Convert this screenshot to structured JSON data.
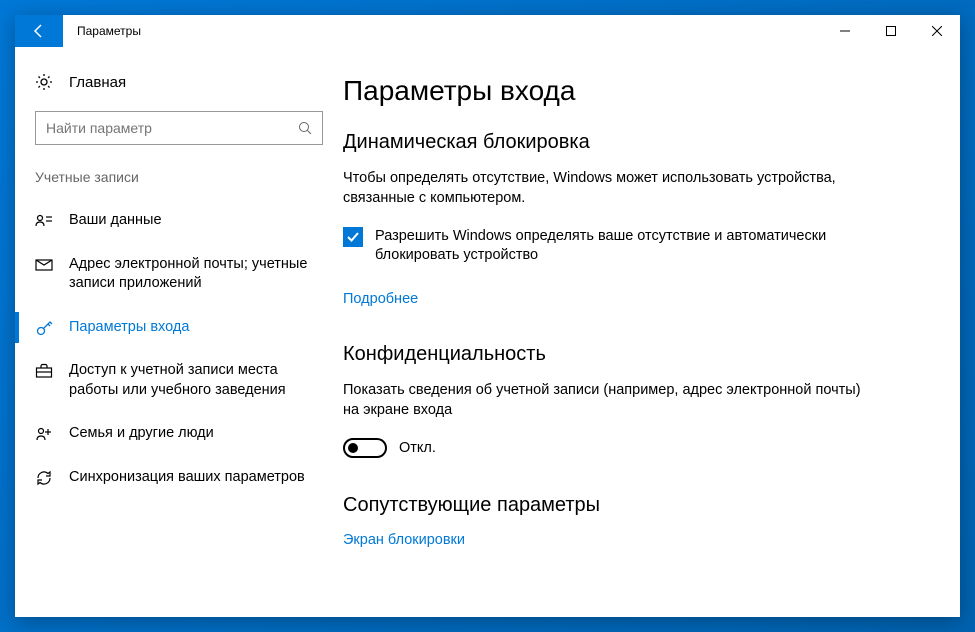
{
  "titlebar": {
    "title": "Параметры"
  },
  "sidebar": {
    "home_label": "Главная",
    "search_placeholder": "Найти параметр",
    "section_label": "Учетные записи",
    "items": [
      {
        "label": "Ваши данные"
      },
      {
        "label": "Адрес электронной почты; учетные записи приложений"
      },
      {
        "label": "Параметры входа"
      },
      {
        "label": "Доступ к учетной записи места работы или учебного заведения"
      },
      {
        "label": "Семья и другие люди"
      },
      {
        "label": "Синхронизация ваших параметров"
      }
    ]
  },
  "main": {
    "page_title": "Параметры входа",
    "dynamic_lock": {
      "heading": "Динамическая блокировка",
      "description": "Чтобы определять отсутствие, Windows может использовать устройства, связанные с компьютером.",
      "checkbox_label": "Разрешить Windows определять ваше отсутствие и автоматически блокировать устройство",
      "checkbox_checked": true,
      "link": "Подробнее"
    },
    "privacy": {
      "heading": "Конфиденциальность",
      "description": "Показать сведения об учетной записи (например, адрес электронной почты) на экране входа",
      "toggle_state": "Откл.",
      "toggle_on": false
    },
    "related": {
      "heading": "Сопутствующие параметры",
      "link": "Экран блокировки"
    }
  }
}
